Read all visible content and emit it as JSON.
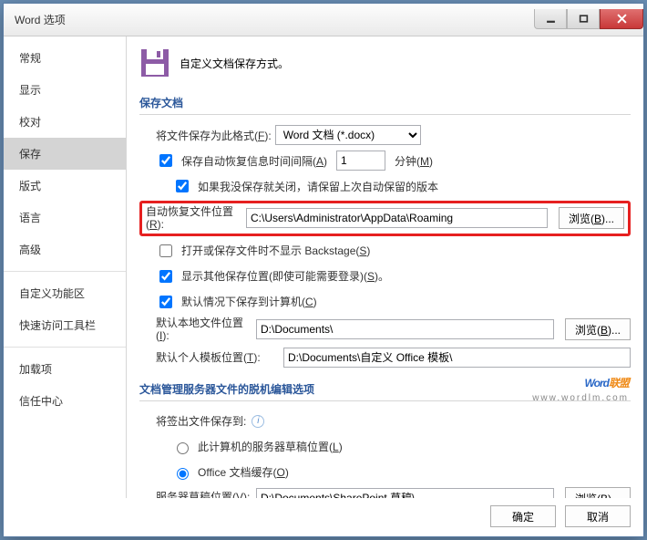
{
  "window": {
    "title": "Word 选项"
  },
  "sidebar": {
    "items": [
      {
        "label": "常规"
      },
      {
        "label": "显示"
      },
      {
        "label": "校对"
      },
      {
        "label": "保存",
        "selected": true
      },
      {
        "label": "版式"
      },
      {
        "label": "语言"
      },
      {
        "label": "高级"
      },
      {
        "label": "自定义功能区"
      },
      {
        "label": "快速访问工具栏"
      },
      {
        "label": "加载项"
      },
      {
        "label": "信任中心"
      }
    ]
  },
  "header": {
    "text": "自定义文档保存方式。"
  },
  "section1": {
    "title": "保存文档",
    "format_label_a": "将文件保存为此格式(",
    "format_hotkey": "F",
    "format_label_b": "):",
    "format_value": "Word 文档 (*.docx)",
    "autosave_chk": true,
    "autosave_a": "保存自动恢复信息时间间隔(",
    "autosave_hk": "A",
    "autosave_b": ")",
    "autosave_interval": "1",
    "min_a": "分钟(",
    "min_hk": "M",
    "min_b": ")",
    "keeplast_chk": true,
    "keeplast": "如果我没保存就关闭，请保留上次自动保留的版本",
    "autorec_a": "自动恢复文件位置(",
    "autorec_hk": "R",
    "autorec_b": "):",
    "autorec_path": "C:\\Users\\Administrator\\AppData\\Roaming",
    "browse_a": "浏览(",
    "browse_hk": "B",
    "browse_b": ")...",
    "backstage_chk": false,
    "backstage_a": "打开或保存文件时不显示 Backstage(",
    "backstage_hk": "S",
    "backstage_b": ")",
    "other_chk": true,
    "other_a": "显示其他保存位置(即使可能需要登录)(",
    "other_hk": "S",
    "other_b": ")。",
    "local_chk": true,
    "local_a": "默认情况下保存到计算机(",
    "local_hk": "C",
    "local_b": ")",
    "defloc_a": "默认本地文件位置(",
    "defloc_hk": "I",
    "defloc_b": "):",
    "defloc_path": "D:\\Documents\\",
    "tmpl_a": "默认个人模板位置(",
    "tmpl_hk": "T",
    "tmpl_b": "):",
    "tmpl_path": "D:\\Documents\\自定义 Office 模板\\"
  },
  "section2": {
    "title": "文档管理服务器文件的脱机编辑选项",
    "checkout_label": "将签出文件保存到:",
    "r1_a": "此计算机的服务器草稿位置(",
    "r1_hk": "L",
    "r1_b": ")",
    "r2_a": "Office 文档缓存(",
    "r2_hk": "O",
    "r2_b": ")",
    "draft_a": "服务器草稿位置(",
    "draft_hk": "V",
    "draft_b": "):",
    "draft_path": "D:\\Documents\\SharePoint 草稿\\"
  },
  "buttons": {
    "ok": "确定",
    "cancel": "取消"
  },
  "watermark": {
    "line1a": "Word",
    "line1b": "联盟",
    "line2": "www.wordlm.com"
  }
}
